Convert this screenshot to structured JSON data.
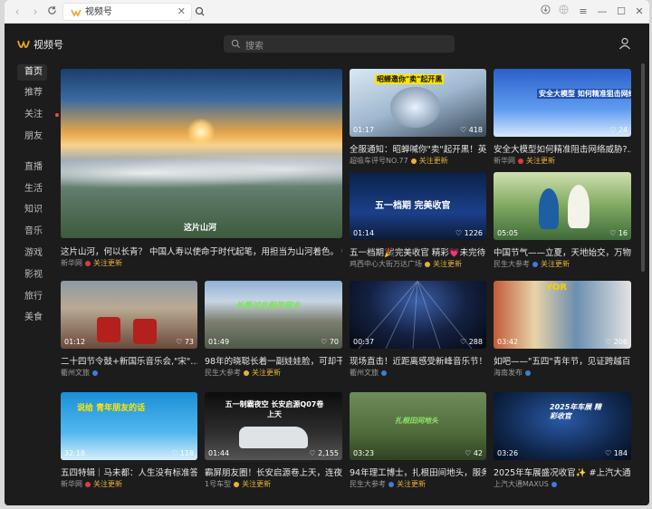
{
  "browser": {
    "tab_title": "视频号",
    "nav": [
      "back",
      "forward",
      "reload"
    ],
    "right_icons": [
      "download-icon",
      "globe-icon",
      "minimize-icon",
      "maximize-icon",
      "close-icon"
    ]
  },
  "header": {
    "logo_text": "视频号",
    "search_placeholder": "搜索"
  },
  "sidebar": {
    "items": [
      {
        "label": "首页",
        "active": true
      },
      {
        "label": "推荐"
      },
      {
        "label": "关注",
        "dot": true
      },
      {
        "label": "朋友"
      },
      {
        "label": "直播"
      },
      {
        "label": "生活"
      },
      {
        "label": "知识"
      },
      {
        "label": "音乐"
      },
      {
        "label": "游戏"
      },
      {
        "label": "影视"
      },
      {
        "label": "旅行"
      },
      {
        "label": "美食"
      }
    ]
  },
  "feed": {
    "featured": {
      "overlay": "这片山河",
      "title": "这片山河，何以长青？ 中国人寿以使命于时代起笔，用担当为山河着色。 每…",
      "author": "新华网",
      "update": "关注更新"
    },
    "cards": [
      {
        "title": "全服通知：昭蝉喊你\"卖\"起开黑！英…",
        "author": "超吸车评号NO.77",
        "update": "关注更新",
        "duration": "01:17",
        "likes": "418",
        "overlay": "昭蝉邀你\"卖\"起开黑"
      },
      {
        "title": "安全大模型如何精准阻击网络威胁?…",
        "author": "新华网",
        "update": "关注更新",
        "duration": "",
        "likes": "24",
        "overlay": "安全大模型 如何精准狙击网络威胁?"
      },
      {
        "title": "五一档期🎉完美收官 精彩💗未完待…",
        "author": "鸡西中心大街万达广场",
        "update": "关注更新",
        "duration": "01:14",
        "likes": "1226",
        "overlay": "五一档期 完美收官"
      },
      {
        "title": "中国节气——立夏，天地始交，万物…",
        "author": "民生大参考",
        "update": "关注更新",
        "duration": "05:05",
        "likes": "16",
        "overlay": ""
      },
      {
        "title": "二十四节令鼓+新国乐音乐会,\"宋\"…",
        "author": "衢州文旅",
        "update": "",
        "duration": "01:12",
        "likes": "73",
        "overlay": ""
      },
      {
        "title": "98年的晓聪长着一副娃娃脸，可却干…",
        "author": "民生大参考",
        "update": "关注更新",
        "duration": "01:49",
        "likes": "70",
        "overlay": "长看过此般的家乡"
      },
      {
        "title": "现场直击！近距离感受新峰音乐节！…",
        "author": "衢州文旅",
        "update": "",
        "duration": "00:37",
        "likes": "288",
        "overlay": ""
      },
      {
        "title": "如吧——\"五四\"青年节，见证跨越百…",
        "author": "海南发布",
        "update": "",
        "duration": "03:42",
        "likes": "206",
        "overlay": "YOR"
      },
      {
        "title": "五四特辑｜马未都：人生没有标准答…",
        "author": "新华网",
        "update": "关注更新",
        "duration": "32:18",
        "likes": "118",
        "overlay": "说给 青年朋友的话"
      },
      {
        "title": "霸屏朋友圈！长安启源卷上天，连夜…",
        "author": "1号车型",
        "update": "关注更新",
        "duration": "01:44",
        "likes": "2,155",
        "overlay": "五一制霸夜空 长安启源Q07卷上天"
      },
      {
        "title": "94年理工博士，扎根田间地头，服务…",
        "author": "民生大参考",
        "update": "关注更新",
        "duration": "03:23",
        "likes": "42",
        "overlay": "扎根田间地头"
      },
      {
        "title": "2025年车展盛况收官✨ #上汽大通…",
        "author": "上汽大通MAXUS",
        "update": "",
        "duration": "03:26",
        "likes": "184",
        "overlay": "2025年车展 精彩收官"
      }
    ]
  },
  "colors": {
    "bg": "#1c1c1c",
    "accent_update": "#e6b23a",
    "logo": "#f0a020"
  }
}
